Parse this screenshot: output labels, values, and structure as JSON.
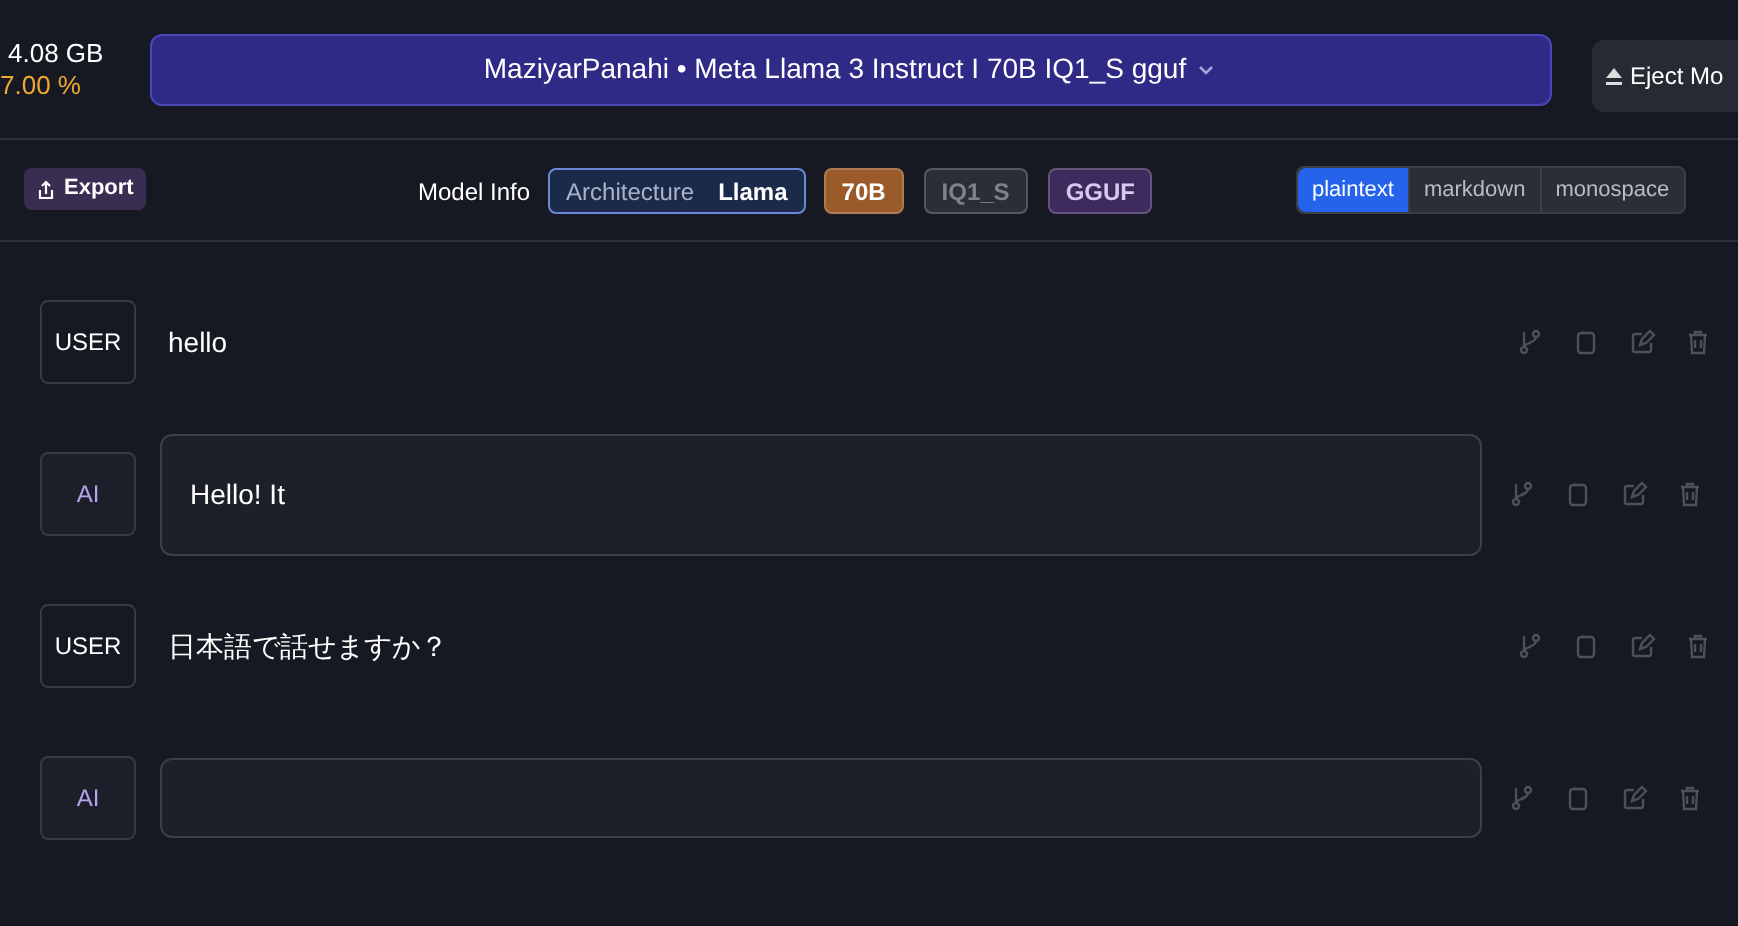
{
  "stats": {
    "memory": "4.08 GB",
    "usage": "7.00 %"
  },
  "model_button": {
    "label": "MaziyarPanahi • Meta Llama 3 Instruct I 70B IQ1_S gguf"
  },
  "eject_button": {
    "label": "Eject Mo"
  },
  "export_button": {
    "label": "Export"
  },
  "model_info": {
    "label": "Model Info",
    "architecture": {
      "label": "Architecture",
      "value": "Llama"
    },
    "tags": [
      {
        "text": "70B",
        "color": "#9a5a2a"
      },
      {
        "text": "IQ1_S",
        "color": "#2a2e36"
      },
      {
        "text": "GGUF",
        "color": "#3e2a5c"
      }
    ]
  },
  "formats": [
    {
      "label": "plaintext",
      "selected": true
    },
    {
      "label": "markdown",
      "selected": false
    },
    {
      "label": "monospace",
      "selected": false
    }
  ],
  "messages": [
    {
      "kind": "user",
      "badge": "USER",
      "text": "hello"
    },
    {
      "kind": "ai",
      "badge": "AI",
      "text": "Hello! It"
    },
    {
      "kind": "user",
      "badge": "USER",
      "text": "日本語で話せますか？"
    },
    {
      "kind": "ai",
      "badge": "AI"
    }
  ]
}
